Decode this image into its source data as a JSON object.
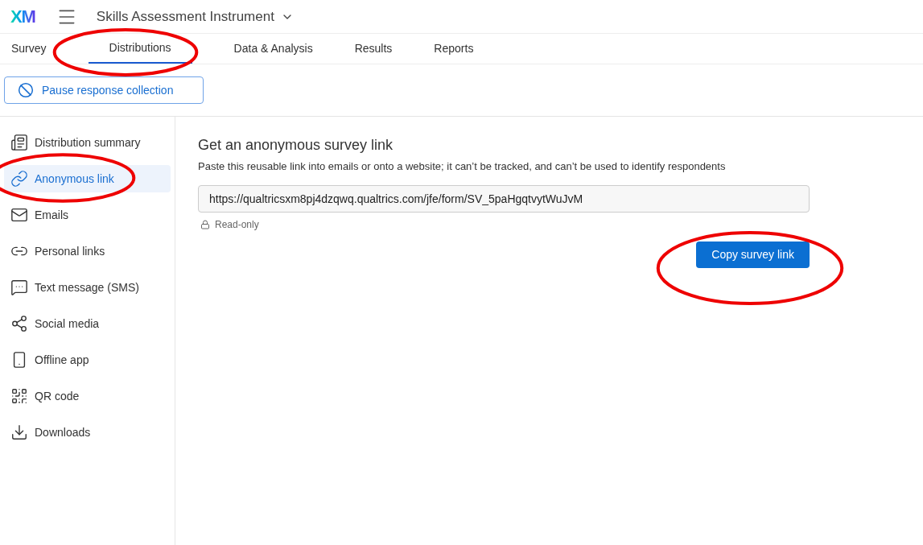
{
  "header": {
    "logo": "XM",
    "project_title": "Skills Assessment Instrument"
  },
  "tabs": [
    {
      "label": "Survey",
      "selected": false
    },
    {
      "label": "Distributions",
      "selected": true
    },
    {
      "label": "Data & Analysis",
      "selected": false
    },
    {
      "label": "Results",
      "selected": false
    },
    {
      "label": "Reports",
      "selected": false
    }
  ],
  "pause_button": "Pause response collection",
  "sidebar": {
    "items": [
      {
        "label": "Distribution summary",
        "selected": false
      },
      {
        "label": "Anonymous link",
        "selected": true
      },
      {
        "label": "Emails",
        "selected": false
      },
      {
        "label": "Personal links",
        "selected": false
      },
      {
        "label": "Text message (SMS)",
        "selected": false
      },
      {
        "label": "Social media",
        "selected": false
      },
      {
        "label": "Offline app",
        "selected": false
      },
      {
        "label": "QR code",
        "selected": false
      },
      {
        "label": "Downloads",
        "selected": false
      }
    ]
  },
  "main": {
    "title": "Get an anonymous survey link",
    "description": "Paste this reusable link into emails or onto a website; it can’t be tracked, and can’t be used to identify respondents",
    "link_value": "https://qualtricsxm8pj4dzqwq.qualtrics.com/jfe/form/SV_5paHgqtvytWuJvM",
    "read_only_label": "Read-only",
    "copy_button": "Copy survey link"
  }
}
